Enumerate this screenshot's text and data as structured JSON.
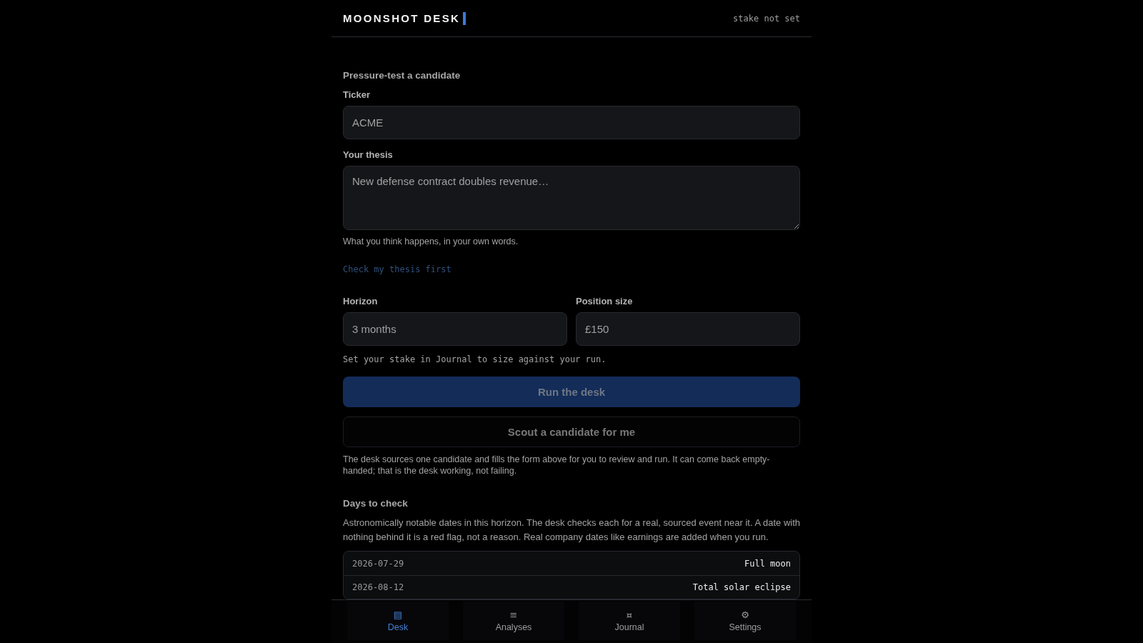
{
  "header": {
    "title": "MOONSHOT DESK",
    "stake_status": "stake not set"
  },
  "candidate_form": {
    "heading": "Pressure-test a candidate",
    "ticker": {
      "label": "Ticker",
      "placeholder": "ACME"
    },
    "thesis": {
      "label": "Your thesis",
      "placeholder": "New defense contract doubles revenue…",
      "hint": "What you think happens, in your own words."
    },
    "check_thesis_link": {
      "label": "Check my thesis first",
      "disabled": true
    },
    "horizon": {
      "label": "Horizon",
      "value": "3 months"
    },
    "position_size": {
      "label": "Position size",
      "placeholder": "£150"
    },
    "stake_hint": "Set your stake in Journal to size against your run.",
    "run_button": {
      "label": "Run the desk",
      "disabled": true
    },
    "scout_button": {
      "label": "Scout a candidate for me",
      "disabled": true
    },
    "scout_note": "The desk sources one candidate and fills the form above for you to review and run. It can come back empty-handed; that is the desk working, not failing."
  },
  "days_to_check": {
    "heading": "Days to check",
    "description": "Astronomically notable dates in this horizon. The desk checks each for a real, sourced event near it. A date with nothing behind it is a red flag, not a reason. Real company dates like earnings are added when you run.",
    "rows": [
      {
        "date": "2026-07-29",
        "event": "Full moon"
      },
      {
        "date": "2026-08-12",
        "event": "Total solar eclipse"
      }
    ]
  },
  "bottom_nav": [
    {
      "icon": "▤",
      "label": "Desk",
      "selected": true
    },
    {
      "icon": "≡",
      "label": "Analyses",
      "selected": false
    },
    {
      "icon": "¤",
      "label": "Journal",
      "selected": false
    },
    {
      "icon": "⚙",
      "label": "Settings",
      "selected": false
    }
  ]
}
